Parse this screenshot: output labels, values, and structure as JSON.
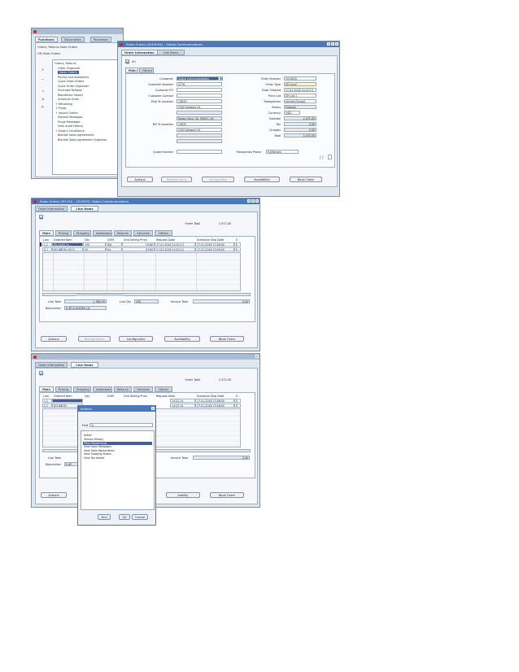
{
  "win1": {
    "nav_tabs": [
      "Functions",
      "Documents",
      "Processes"
    ],
    "nav_title_1": "Orders, Returns Sales Orders",
    "nav_title_2": "OM Sales Orders",
    "nav_items": [
      "Orders, Returns",
      "Order Organizer",
      "Sales Orders",
      "Pricing and Availability",
      "Quick Sales Orders",
      "Quick Order Organizer",
      "Purchase Release",
      "Requisition Import",
      "Schedule Order",
      "Reholding",
      "Purge",
      "Import Orders",
      "Process Messages",
      "Purge Messages",
      "View Audit History",
      "Export Compliance",
      "Blanket Sales Agreements",
      "Blanket Sales Agreement Organizer"
    ],
    "title": "Sales Orders (2019032) - Global Communications",
    "tabs": [
      "Order Information",
      "Line Items"
    ],
    "sub_tabs": [
      "Main",
      "Others"
    ],
    "toolbar_label": "SH",
    "left_fields": [
      {
        "label": "Customer",
        "value": "Global Communications"
      },
      {
        "label": "Customer Number",
        "value": "5776"
      },
      {
        "label": "Customer PO",
        "value": ""
      },
      {
        "label": "Customer Contact",
        "value": ""
      },
      {
        "label": "Ship To Location",
        "value": "13633"
      },
      {
        "label": "",
        "value": "2300 Network Dr."
      },
      {
        "label": "",
        "value": ""
      },
      {
        "label": "",
        "value": "Santa Clara, CA, 95051, US"
      },
      {
        "label": "Bill To Location",
        "value": "13633"
      },
      {
        "label": "",
        "value": "2300 Network Dr."
      },
      {
        "label": "",
        "value": ""
      },
      {
        "label": "",
        "value": ""
      },
      {
        "label": "Quote Number",
        "value": ""
      }
    ],
    "right_fields": [
      {
        "label": "Order Number",
        "value": "2019032"
      },
      {
        "label": "Order Type",
        "value": "EH Local"
      },
      {
        "label": "Date Ordered",
        "value": "17-01-2016 14:22:14"
      },
      {
        "label": "Price List",
        "value": "EH List 1"
      },
      {
        "label": "Salesperson",
        "value": "Ahmed Elshazli,"
      },
      {
        "label": "Status",
        "value": "Entered"
      },
      {
        "label": "Currency",
        "value": "USD"
      },
      {
        "label": "Subtotal",
        "value": "2,472.00"
      },
      {
        "label": "Tax",
        "value": "0.00"
      },
      {
        "label": "Charges",
        "value": "0.00"
      },
      {
        "label": "Total",
        "value": "2,472.00"
      }
    ],
    "transaction_phase_label": "Transaction Phase",
    "transaction_phase_value": "Fulfillment",
    "page_indicator": "[ ]",
    "buttons": [
      "Actions",
      "Related Items",
      "Configurator",
      "Availability",
      "Book Order"
    ]
  },
  "win2": {
    "title": "Sales Orders (EH OU) - 2019032, Global Communications",
    "tabs": [
      "Order Information",
      "Line Items"
    ],
    "order_total_label": "Order Total",
    "order_total_value": "2,472.00",
    "sub_tabs": [
      "Main",
      "Pricing",
      "Shipping",
      "Addresses",
      "Returns",
      "Services",
      "Others"
    ],
    "columns": [
      "Line",
      "Ordered Item",
      "Qty",
      "UOM",
      "Unit Selling Price",
      "Request Date",
      "Schedule Ship Date",
      "S"
    ],
    "rows": [
      [
        "1.1",
        "EH-44E6-7e...",
        "100",
        "IEA",
        "19.80",
        "17-01-2016 14:22:14",
        "17-01-2016 23:58:00",
        "E"
      ],
      [
        "2.1",
        "DO-8853h-0110",
        "20",
        "Ea",
        "24.60",
        "17-01-2016 14:22:14",
        "17-01-2016 23:59:00",
        "E"
      ]
    ],
    "line_total_label": "Line Total",
    "line_total_value": "1,980.00",
    "line_qty_label": "Line Qty",
    "line_qty_value": "100",
    "service_total_label": "Service Total",
    "service_total_value": "0.00",
    "description_label": "Description",
    "description_value": "E-4E-6 4e10Eb s A",
    "buttons": [
      "Actions",
      "Related Items",
      "Configurator",
      "Availability",
      "Book Order"
    ]
  },
  "win3": {
    "tabs": [
      "Order Information",
      "Line Items"
    ],
    "order_total_label": "Order Total",
    "order_total_value": "2,472.00",
    "sub_tabs": [
      "Main",
      "Pricing",
      "Shipping",
      "Addresses",
      "Returns",
      "Services",
      "Others"
    ],
    "columns": [
      "Line",
      "Ordered Item",
      "Qty",
      "UOM",
      "Unit Selling Price",
      "Request Date",
      "Schedule Ship Date",
      "S"
    ],
    "rows": [
      [
        "1.1",
        "",
        "",
        "",
        "",
        "14:22:14",
        "17-01-2016 23:58:00",
        "E"
      ],
      [
        "2.1",
        "DO-8853h",
        "",
        "",
        "",
        "14:22:14",
        "17-01-2016 23:58:00",
        "E"
      ]
    ],
    "line_total_label": "Line Total",
    "service_total_label": "Service Total",
    "service_total_value": "0.00",
    "description_label": "Description",
    "description_value": "E-4E",
    "buttons": [
      "Actions",
      "",
      "",
      "ilability",
      "Book Order"
    ],
    "dialog": {
      "title": "Actions",
      "find_label": "Find",
      "find_value": "%",
      "list_header": "Action",
      "items": [
        "Version History",
        "View Adjustments",
        "View Open Messages",
        "View Sales Agreements",
        "View Shipping Status",
        "View Tax details"
      ],
      "selected_index": 1,
      "buttons": [
        "Find",
        "OK",
        "Cancel"
      ]
    }
  }
}
